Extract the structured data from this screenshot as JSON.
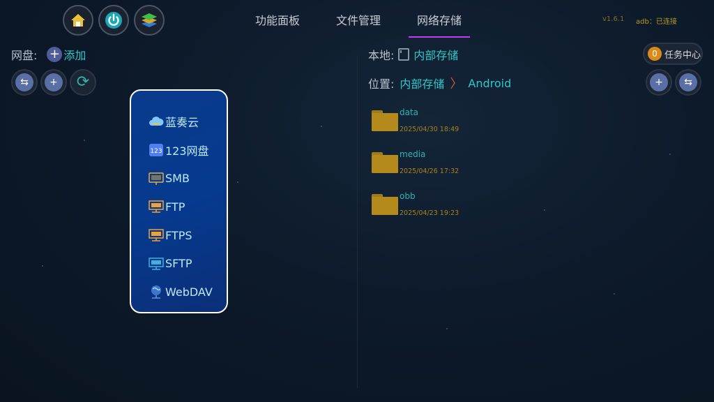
{
  "top_tabs": [
    {
      "label": "功能面板",
      "active": false
    },
    {
      "label": "文件管理",
      "active": false
    },
    {
      "label": "网络存储",
      "active": true
    }
  ],
  "top_icons": [
    "home-icon",
    "power-icon",
    "layers-icon"
  ],
  "version": "v1.6.1",
  "adb_status": "adb：已连接",
  "left_panel": {
    "label": "网盘:",
    "add_label": "添加",
    "tools": [
      "swap-icon",
      "plus-icon",
      "refresh-icon"
    ]
  },
  "popup": {
    "items": [
      {
        "label": "蓝奏云",
        "icon": "lanzou-cloud-icon"
      },
      {
        "label": "123网盘",
        "icon": "pan123-icon"
      },
      {
        "label": "SMB",
        "icon": "smb-icon"
      },
      {
        "label": "FTP",
        "icon": "ftp-icon"
      },
      {
        "label": "FTPS",
        "icon": "ftps-icon"
      },
      {
        "label": "SFTP",
        "icon": "sftp-icon"
      },
      {
        "label": "WebDAV",
        "icon": "webdav-icon"
      }
    ]
  },
  "right_panel": {
    "local_label": "本地:",
    "local_value": "内部存储",
    "task_count": "0",
    "task_label": "任务中心",
    "path_label": "位置:",
    "path_root": "内部存储",
    "path_sub": "Android",
    "tools": [
      "plus-icon",
      "swap-icon"
    ],
    "files": [
      {
        "name": "data",
        "date": "2025/04/30 18:49"
      },
      {
        "name": "media",
        "date": "2025/04/26 17:32"
      },
      {
        "name": "obb",
        "date": "2025/04/23 19:23"
      }
    ]
  },
  "colors": {
    "accent_cyan": "#2ec8c8",
    "tab_underline": "#c23cff",
    "popup_bg": "#063a8f",
    "folder": "#b58a1c",
    "date_text": "#a8831e"
  }
}
